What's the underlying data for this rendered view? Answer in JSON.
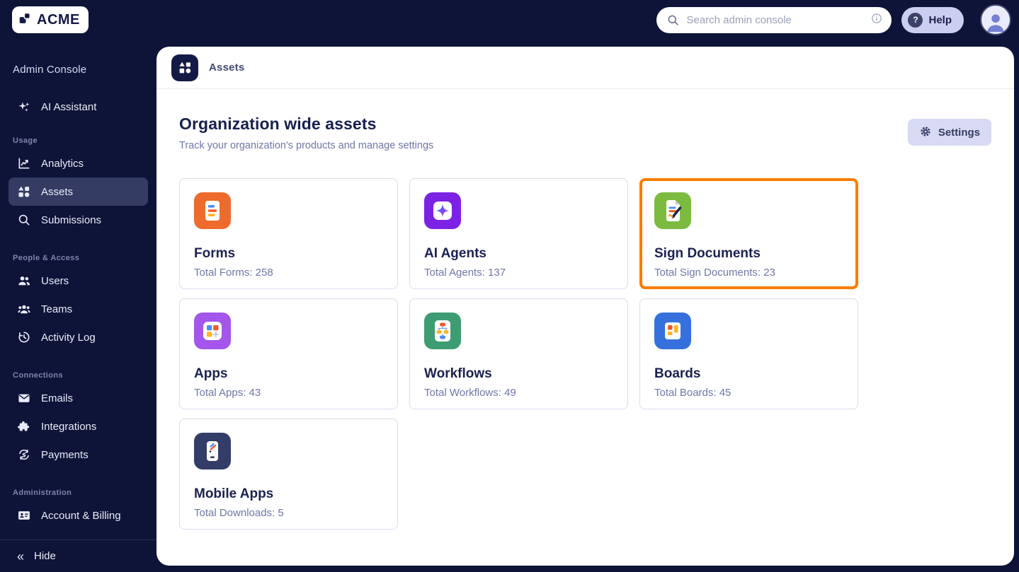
{
  "topbar": {
    "logo_text": "ACME",
    "search_placeholder": "Search admin console",
    "help_label": "Help"
  },
  "sidebar": {
    "title": "Admin Console",
    "assistant_label": "AI Assistant",
    "sections": [
      {
        "label": "Usage",
        "items": [
          {
            "label": "Analytics",
            "active": false
          },
          {
            "label": "Assets",
            "active": true
          },
          {
            "label": "Submissions",
            "active": false
          }
        ]
      },
      {
        "label": "People & Access",
        "items": [
          {
            "label": "Users",
            "active": false
          },
          {
            "label": "Teams",
            "active": false
          },
          {
            "label": "Activity Log",
            "active": false
          }
        ]
      },
      {
        "label": "Connections",
        "items": [
          {
            "label": "Emails",
            "active": false
          },
          {
            "label": "Integrations",
            "active": false
          },
          {
            "label": "Payments",
            "active": false
          }
        ]
      },
      {
        "label": "Administration",
        "items": [
          {
            "label": "Account & Billing",
            "active": false
          }
        ]
      }
    ],
    "hide_label": "Hide",
    "hide_icon": "chevron-double-left"
  },
  "main": {
    "breadcrumb": "Assets",
    "title": "Organization wide assets",
    "subtitle": "Track your organization's products and manage settings",
    "settings_label": "Settings",
    "cards": [
      {
        "title": "Forms",
        "stat": "Total Forms: 258",
        "icon": "forms-icon",
        "tile_color": "#EE6B2D",
        "highlighted": false
      },
      {
        "title": "AI Agents",
        "stat": "Total Agents: 137",
        "icon": "ai-agents-icon",
        "tile_color": "#7C22E4",
        "highlighted": false
      },
      {
        "title": "Sign Documents",
        "stat": "Total Sign Documents: 23",
        "icon": "sign-documents-icon",
        "tile_color": "#7CBB3F",
        "highlighted": true
      },
      {
        "title": "Apps",
        "stat": "Total Apps: 43",
        "icon": "apps-icon",
        "tile_color": "#A355EC",
        "highlighted": false
      },
      {
        "title": "Workflows",
        "stat": "Total Workflows: 49",
        "icon": "workflows-icon",
        "tile_color": "#3E9C72",
        "highlighted": false
      },
      {
        "title": "Boards",
        "stat": "Total Boards: 45",
        "icon": "boards-icon",
        "tile_color": "#3670DC",
        "highlighted": false
      },
      {
        "title": "Mobile Apps",
        "stat": "Total Downloads: 5",
        "icon": "mobile-apps-icon",
        "tile_color": "#333D68",
        "highlighted": false
      }
    ]
  },
  "colors": {
    "navy_background": "#0D1438",
    "highlight_border": "#F97C00",
    "active_item_background": "#343C63",
    "button_lavender": "#CBCFEF"
  }
}
